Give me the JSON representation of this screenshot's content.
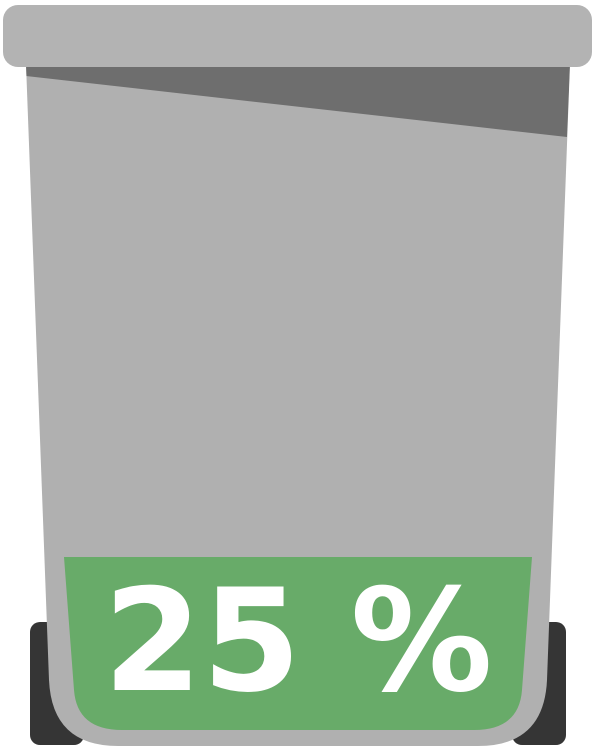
{
  "fill_indicator": {
    "label": "25 %",
    "level_fraction": 0.25,
    "fill_color": "#68ab69"
  },
  "colors": {
    "bin_body": "#b0b0b0",
    "bin_lid": "#b3b3b3",
    "bin_shadow": "#6e6e6e",
    "wheels": "#353535",
    "label_text": "#ffffff"
  },
  "icons": [
    "wheelie-bin-icon"
  ]
}
